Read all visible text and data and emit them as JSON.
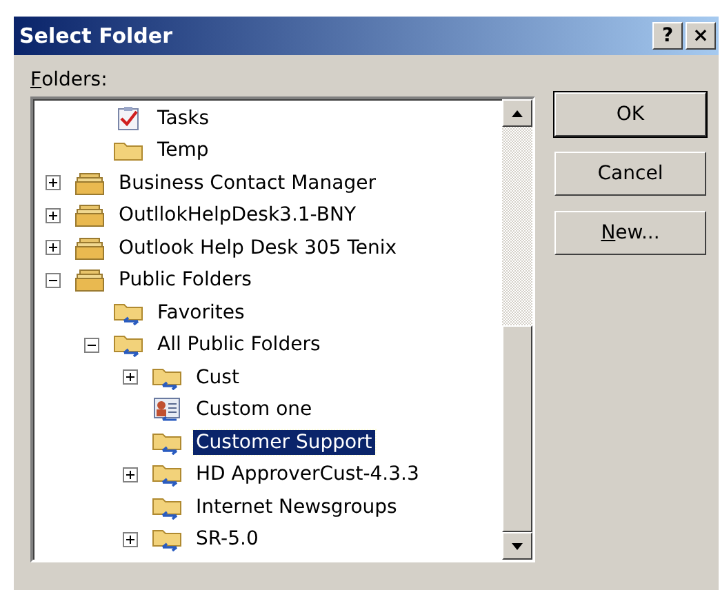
{
  "window": {
    "title": "Select Folder",
    "title_buttons": [
      "?",
      "×"
    ]
  },
  "folders_label": {
    "text": "Folders:",
    "underline_first": true
  },
  "tree": [
    {
      "children": [
        {
          "label": "Tasks",
          "kind": "tasks",
          "selected": false
        },
        {
          "label": "Temp",
          "kind": "folder",
          "selected": false
        }
      ]
    },
    {
      "label": "Business Contact Manager",
      "kind": "store",
      "expanded": false,
      "selected": false
    },
    {
      "label": "OutllokHelpDesk3.1-BNY",
      "kind": "store",
      "expanded": false,
      "selected": false
    },
    {
      "label": "Outlook Help Desk 305 Tenix",
      "kind": "store",
      "expanded": false,
      "selected": false
    },
    {
      "label": "Public Folders",
      "kind": "store",
      "expanded": true,
      "selected": false,
      "children": [
        {
          "label": "Favorites",
          "kind": "public",
          "selected": false
        },
        {
          "label": "All Public Folders",
          "kind": "public",
          "expanded": true,
          "selected": false,
          "children": [
            {
              "label": "Cust",
              "kind": "public",
              "expanded": false,
              "selected": false
            },
            {
              "label": "Custom one",
              "kind": "contacts",
              "selected": false
            },
            {
              "label": "Customer Support",
              "kind": "public",
              "selected": true
            },
            {
              "label": "HD ApproverCust-4.3.3",
              "kind": "public",
              "expanded": false,
              "selected": false
            },
            {
              "label": "Internet Newsgroups",
              "kind": "public",
              "selected": false
            },
            {
              "label": "SR-5.0",
              "kind": "public",
              "expanded": false,
              "selected": false
            }
          ]
        }
      ]
    }
  ],
  "buttons": [
    {
      "label": "OK",
      "default": true,
      "underline_first": false
    },
    {
      "label": "Cancel",
      "default": false,
      "underline_first": false
    },
    {
      "label": "New...",
      "default": false,
      "underline_first": true
    }
  ]
}
